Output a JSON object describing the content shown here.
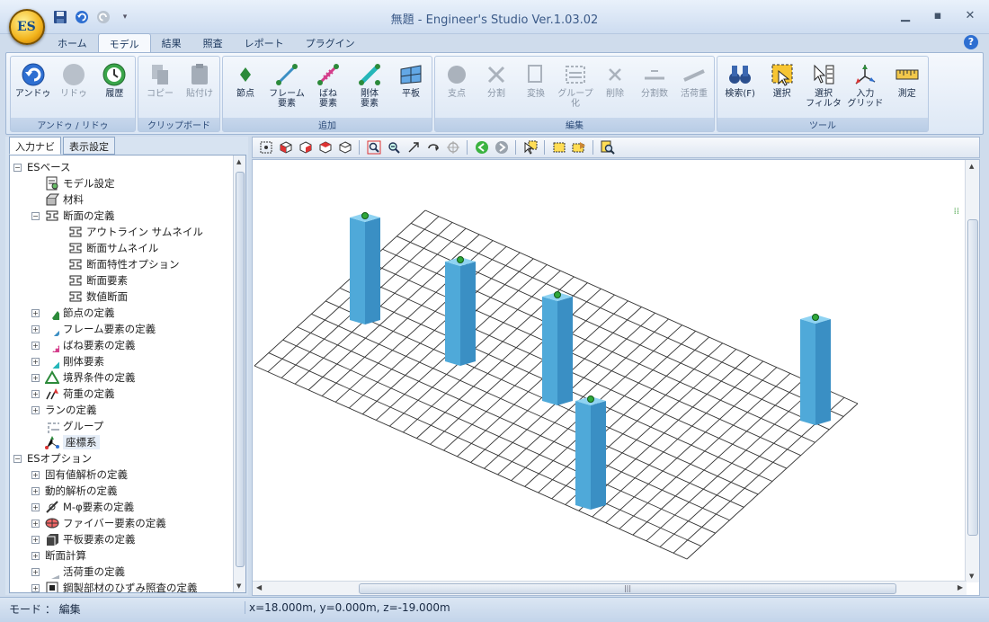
{
  "window": {
    "title": "無題 - Engineer's Studio Ver.1.03.02",
    "orb_text": "ES"
  },
  "tabs": [
    {
      "label": "ホーム",
      "active": false
    },
    {
      "label": "モデル",
      "active": true
    },
    {
      "label": "結果",
      "active": false
    },
    {
      "label": "照査",
      "active": false
    },
    {
      "label": "レポート",
      "active": false
    },
    {
      "label": "プラグイン",
      "active": false
    }
  ],
  "ribbon": {
    "groups": [
      {
        "label": "アンドゥ / リドゥ",
        "buttons": [
          {
            "label": "アンドゥ",
            "icon": "undo-icon",
            "enabled": true
          },
          {
            "label": "リドゥ",
            "icon": "redo-icon",
            "enabled": false
          },
          {
            "label": "履歴",
            "icon": "history-icon",
            "enabled": true
          }
        ]
      },
      {
        "label": "クリップボード",
        "buttons": [
          {
            "label": "コピー",
            "icon": "copy-icon",
            "enabled": false
          },
          {
            "label": "貼付け",
            "icon": "paste-icon",
            "enabled": false
          }
        ]
      },
      {
        "label": "追加",
        "buttons": [
          {
            "label": "節点",
            "icon": "node-icon",
            "enabled": true
          },
          {
            "label": "フレーム\n要素",
            "icon": "frame-element-icon",
            "enabled": true
          },
          {
            "label": "ばね\n要素",
            "icon": "spring-element-icon",
            "enabled": true
          },
          {
            "label": "剛体\n要素",
            "icon": "rigid-element-icon",
            "enabled": true
          },
          {
            "label": "平板",
            "icon": "plate-icon",
            "enabled": true
          }
        ]
      },
      {
        "label": "編集",
        "buttons": [
          {
            "label": "支点",
            "icon": "support-icon",
            "enabled": false
          },
          {
            "label": "分割",
            "icon": "split-icon",
            "enabled": false
          },
          {
            "label": "変換",
            "icon": "convert-icon",
            "enabled": false
          },
          {
            "label": "グループ\n化",
            "icon": "group-icon",
            "enabled": false
          },
          {
            "label": "削除",
            "icon": "delete-icon",
            "enabled": false
          },
          {
            "label": "分割数",
            "icon": "divisions-icon",
            "enabled": false
          },
          {
            "label": "活荷重",
            "icon": "live-load-icon",
            "enabled": false
          }
        ]
      },
      {
        "label": "ツール",
        "buttons": [
          {
            "label": "検索(F)",
            "icon": "search-binoculars-icon",
            "enabled": true
          },
          {
            "label": "選択",
            "icon": "select-icon",
            "enabled": true
          },
          {
            "label": "選択\nフィルタ",
            "icon": "select-filter-icon",
            "enabled": true
          },
          {
            "label": "入力\nグリッド",
            "icon": "input-grid-icon",
            "enabled": true
          },
          {
            "label": "測定",
            "icon": "measure-icon",
            "enabled": true
          }
        ]
      }
    ]
  },
  "left_tabs": [
    "入力ナビ",
    "表示設定"
  ],
  "tree": [
    {
      "label": "ESベース",
      "level": 0,
      "expander": "−",
      "icon": ""
    },
    {
      "label": "モデル設定",
      "level": 1,
      "expander": "",
      "icon": "model-settings-icon"
    },
    {
      "label": "材料",
      "level": 1,
      "expander": "",
      "icon": "material-icon"
    },
    {
      "label": "断面の定義",
      "level": 1,
      "expander": "−",
      "icon": "section-icon"
    },
    {
      "label": "アウトライン サムネイル",
      "level": 2,
      "expander": "",
      "icon": "section-icon"
    },
    {
      "label": "断面サムネイル",
      "level": 2,
      "expander": "",
      "icon": "section-icon"
    },
    {
      "label": "断面特性オプション",
      "level": 2,
      "expander": "",
      "icon": "section-icon"
    },
    {
      "label": "断面要素",
      "level": 2,
      "expander": "",
      "icon": "section-icon"
    },
    {
      "label": "数値断面",
      "level": 2,
      "expander": "",
      "icon": "section-icon"
    },
    {
      "label": "節点の定義",
      "level": 1,
      "expander": "+",
      "icon": "node-icon"
    },
    {
      "label": "フレーム要素の定義",
      "level": 1,
      "expander": "+",
      "icon": "frame-element-icon"
    },
    {
      "label": "ばね要素の定義",
      "level": 1,
      "expander": "+",
      "icon": "spring-element-icon"
    },
    {
      "label": "剛体要素",
      "level": 1,
      "expander": "+",
      "icon": "rigid-element-icon"
    },
    {
      "label": "境界条件の定義",
      "level": 1,
      "expander": "+",
      "icon": "boundary-icon"
    },
    {
      "label": "荷重の定義",
      "level": 1,
      "expander": "+",
      "icon": "load-icon"
    },
    {
      "label": "ランの定義",
      "level": 1,
      "expander": "+",
      "icon": ""
    },
    {
      "label": "グループ",
      "level": 1,
      "expander": "",
      "icon": "group-icon"
    },
    {
      "label": "座標系",
      "level": 1,
      "expander": "",
      "icon": "axes-icon",
      "selected": true
    },
    {
      "label": "ESオプション",
      "level": 0,
      "expander": "−",
      "icon": ""
    },
    {
      "label": "固有値解析の定義",
      "level": 1,
      "expander": "+",
      "icon": ""
    },
    {
      "label": "動的解析の定義",
      "level": 1,
      "expander": "+",
      "icon": ""
    },
    {
      "label": "M-φ要素の定義",
      "level": 1,
      "expander": "+",
      "icon": "m-phi-icon"
    },
    {
      "label": "ファイバー要素の定義",
      "level": 1,
      "expander": "+",
      "icon": "fiber-icon"
    },
    {
      "label": "平板要素の定義",
      "level": 1,
      "expander": "+",
      "icon": "plate-element-icon"
    },
    {
      "label": "断面計算",
      "level": 1,
      "expander": "+",
      "icon": ""
    },
    {
      "label": "活荷重の定義",
      "level": 1,
      "expander": "+",
      "icon": "live-load-icon"
    },
    {
      "label": "鋼製部材のひずみ照査の定義",
      "level": 1,
      "expander": "+",
      "icon": "steel-strain-icon"
    }
  ],
  "status": {
    "mode": "モード ： 編集",
    "coords": "x=18.000m, y=0.000m, z=-19.000m"
  },
  "colors": {
    "accent": "#2e6fd1",
    "column": "#4fb3e6",
    "grid": "#333333"
  }
}
